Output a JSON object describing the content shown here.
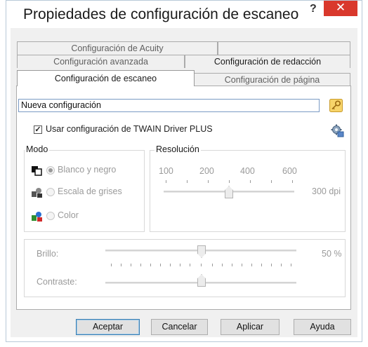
{
  "window": {
    "title": "Propiedades de configuración de escaneo",
    "help_label": "?",
    "close_label": "✕"
  },
  "tabs": {
    "row1": [
      "Configuración de Acuity",
      ""
    ],
    "row2": [
      "Configuración avanzada",
      "Configuración de redacción"
    ],
    "row3": [
      "Configuración de escaneo",
      "Configuración de página"
    ],
    "active": "Configuración de escaneo"
  },
  "config": {
    "name_value": "Nueva configuración",
    "use_twain_label": "Usar configuración de TWAIN Driver PLUS",
    "use_twain_checked": true
  },
  "mode": {
    "legend": "Modo",
    "options": [
      "Blanco y negro",
      "Escala de grises",
      "Color"
    ],
    "selected": "Blanco y negro",
    "icons": [
      "bw-mode-icon",
      "grayscale-mode-icon",
      "color-mode-icon"
    ]
  },
  "resolution": {
    "legend": "Resolución",
    "ticks": [
      "100",
      "200",
      "400",
      "600"
    ],
    "value_label": "300 dpi",
    "value": 300
  },
  "adjust": {
    "brightness_label": "Brillo:",
    "brightness_value": "50 %",
    "brightness_level": 0.5,
    "contrast_label": "Contraste:",
    "contrast_level": 0.5
  },
  "buttons": {
    "ok": "Aceptar",
    "cancel": "Cancelar",
    "apply": "Aplicar",
    "help": "Ayuda"
  },
  "colors": {
    "close": "#d9382c",
    "input_border": "#7a9ac4",
    "default_button": "#3c7fb1"
  }
}
